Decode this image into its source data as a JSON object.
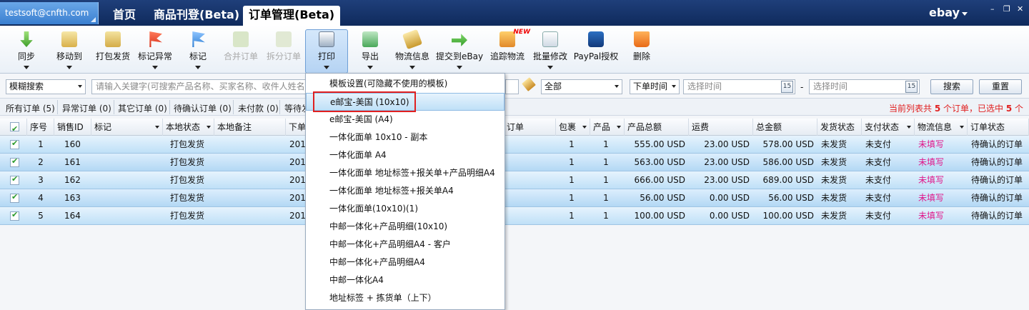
{
  "titlebar": {
    "account": "testsoft@cnfth.com",
    "tabs": [
      "首页",
      "商品刊登(Beta)",
      "订单管理(Beta)"
    ],
    "platform": "ebay",
    "window_controls": [
      "–",
      "❐",
      "✕"
    ]
  },
  "toolbar": {
    "buttons": [
      "同步",
      "移动到",
      "打包发货",
      "标记异常",
      "标记",
      "合并订单",
      "拆分订单",
      "打印",
      "导出",
      "物流信息",
      "提交到eBay",
      "追踪物流",
      "批量修改",
      "PayPal授权",
      "删除"
    ],
    "new_tag": "NEW"
  },
  "search": {
    "mode": "模糊搜索",
    "keyword_placeholder": "请输入关键字(可搜索产品名称、买家名称、收件人姓名",
    "status": "全部",
    "time_type": "下单时间",
    "start_placeholder": "选择时间",
    "range_sep": "-",
    "end_placeholder": "选择时间",
    "calendar_day": "15",
    "search_button": "搜索",
    "reset_button": "重置"
  },
  "filters": {
    "items": [
      "所有订单 (5)",
      "异常订单 (0)",
      "其它订单 (0)",
      "待确认订单 (0)",
      "未付款 (0)",
      "等待发"
    ],
    "summary_prefix": "当前列表共 ",
    "summary_total": "5",
    "summary_mid": " 个订单，已选中 ",
    "summary_selected": "5",
    "summary_suffix": " 个"
  },
  "grid": {
    "headers": [
      "序号",
      "销售ID",
      "标记",
      "本地状态",
      "本地备注",
      "下单",
      "订单",
      "包裹",
      "产品",
      "产品总额",
      "运费",
      "总金额",
      "发货状态",
      "支付状态",
      "物流信息",
      "订单状态"
    ],
    "rows": [
      {
        "no": "1",
        "sale_id": "160",
        "local_status": "打包发货",
        "order_date": "201",
        "package": "1",
        "product": "1",
        "product_total": "555.00 USD",
        "shipping": "23.00 USD",
        "total": "578.00 USD",
        "ship_status": "未发货",
        "pay_status": "未支付",
        "logistics": "未填写",
        "order_status": "待确认的订单"
      },
      {
        "no": "2",
        "sale_id": "161",
        "local_status": "打包发货",
        "order_date": "201",
        "package": "1",
        "product": "1",
        "product_total": "563.00 USD",
        "shipping": "23.00 USD",
        "total": "586.00 USD",
        "ship_status": "未发货",
        "pay_status": "未支付",
        "logistics": "未填写",
        "order_status": "待确认的订单"
      },
      {
        "no": "3",
        "sale_id": "162",
        "local_status": "打包发货",
        "order_date": "201",
        "package": "1",
        "product": "1",
        "product_total": "666.00 USD",
        "shipping": "23.00 USD",
        "total": "689.00 USD",
        "ship_status": "未发货",
        "pay_status": "未支付",
        "logistics": "未填写",
        "order_status": "待确认的订单"
      },
      {
        "no": "4",
        "sale_id": "163",
        "local_status": "打包发货",
        "order_date": "201",
        "package": "1",
        "product": "1",
        "product_total": "56.00 USD",
        "shipping": "0.00 USD",
        "total": "56.00 USD",
        "ship_status": "未发货",
        "pay_status": "未支付",
        "logistics": "未填写",
        "order_status": "待确认的订单"
      },
      {
        "no": "5",
        "sale_id": "164",
        "local_status": "打包发货",
        "order_date": "201",
        "package": "1",
        "product": "1",
        "product_total": "100.00 USD",
        "shipping": "0.00 USD",
        "total": "100.00 USD",
        "ship_status": "未发货",
        "pay_status": "未支付",
        "logistics": "未填写",
        "order_status": "待确认的订单"
      }
    ]
  },
  "print_menu": {
    "items": [
      "模板设置(可隐藏不使用的模板)",
      "e邮宝-美国 (10x10)",
      "e邮宝-美国 (A4)",
      "一体化面单 10x10 - 副本",
      "一体化面单 A4",
      "一体化面单 地址标签+报关单+产品明细A4",
      "一体化面单 地址标签+报关单A4",
      "一体化面单(10x10)(1)",
      "中邮一体化+产品明细(10x10)",
      "中邮一体化+产品明细A4 - 客户",
      "中邮一体化+产品明细A4",
      "中邮一体化A4",
      "地址标签 + 拣货单（上下）"
    ],
    "highlighted_index": 1
  },
  "colors": {
    "titlebar": "#1f3f7a",
    "row_selected": "#bfe0f7",
    "logistics_unfilled": "#e0168a",
    "summary_red": "#e02020",
    "annotation_box": "#e02020"
  }
}
